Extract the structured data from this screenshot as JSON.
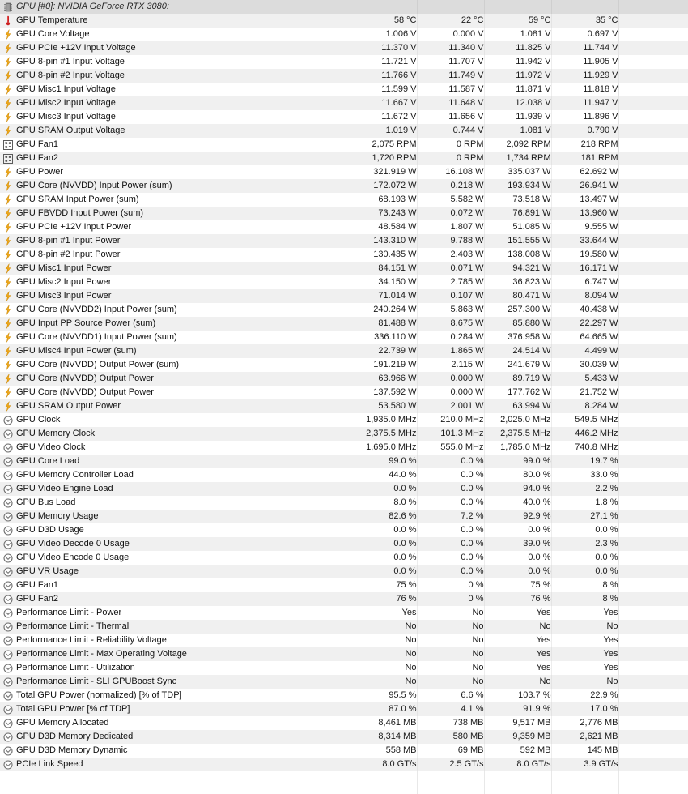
{
  "window": {
    "title": "GPU [#0]: NVIDIA GeForce RTX 3080:",
    "device_icon": "chip-icon"
  },
  "colors": {
    "row_odd": "#f0f0f0",
    "row_even": "#ffffff",
    "header_band": "#dcdcdc",
    "divider": "#e4e4e4",
    "thermometer": "#cc2020",
    "bolt": "#f0a818",
    "fan": "#5b5b5b",
    "gauge": "#6e6e6e",
    "text": "#111111"
  },
  "columns": {
    "label": "",
    "current": "",
    "minimum": "",
    "maximum": "",
    "average": ""
  },
  "rows": [
    {
      "icon": "thermometer-icon",
      "label": "GPU Temperature",
      "current": "58 °C",
      "minimum": "22 °C",
      "maximum": "59 °C",
      "average": "35 °C"
    },
    {
      "icon": "bolt-icon",
      "label": "GPU Core Voltage",
      "current": "1.006 V",
      "minimum": "0.000 V",
      "maximum": "1.081 V",
      "average": "0.697 V"
    },
    {
      "icon": "bolt-icon",
      "label": "GPU PCIe +12V Input Voltage",
      "current": "11.370 V",
      "minimum": "11.340 V",
      "maximum": "11.825 V",
      "average": "11.744 V"
    },
    {
      "icon": "bolt-icon",
      "label": "GPU 8-pin #1 Input Voltage",
      "current": "11.721 V",
      "minimum": "11.707 V",
      "maximum": "11.942 V",
      "average": "11.905 V"
    },
    {
      "icon": "bolt-icon",
      "label": "GPU 8-pin #2 Input Voltage",
      "current": "11.766 V",
      "minimum": "11.749 V",
      "maximum": "11.972 V",
      "average": "11.929 V"
    },
    {
      "icon": "bolt-icon",
      "label": "GPU Misc1 Input Voltage",
      "current": "11.599 V",
      "minimum": "11.587 V",
      "maximum": "11.871 V",
      "average": "11.818 V"
    },
    {
      "icon": "bolt-icon",
      "label": "GPU Misc2 Input Voltage",
      "current": "11.667 V",
      "minimum": "11.648 V",
      "maximum": "12.038 V",
      "average": "11.947 V"
    },
    {
      "icon": "bolt-icon",
      "label": "GPU Misc3 Input Voltage",
      "current": "11.672 V",
      "minimum": "11.656 V",
      "maximum": "11.939 V",
      "average": "11.896 V"
    },
    {
      "icon": "bolt-icon",
      "label": "GPU SRAM Output Voltage",
      "current": "1.019 V",
      "minimum": "0.744 V",
      "maximum": "1.081 V",
      "average": "0.790 V"
    },
    {
      "icon": "fan-icon",
      "label": "GPU Fan1",
      "current": "2,075 RPM",
      "minimum": "0 RPM",
      "maximum": "2,092 RPM",
      "average": "218 RPM"
    },
    {
      "icon": "fan-icon",
      "label": "GPU Fan2",
      "current": "1,720 RPM",
      "minimum": "0 RPM",
      "maximum": "1,734 RPM",
      "average": "181 RPM"
    },
    {
      "icon": "bolt-icon",
      "label": "GPU Power",
      "current": "321.919 W",
      "minimum": "16.108 W",
      "maximum": "335.037 W",
      "average": "62.692 W"
    },
    {
      "icon": "bolt-icon",
      "label": "GPU Core (NVVDD) Input Power (sum)",
      "current": "172.072 W",
      "minimum": "0.218 W",
      "maximum": "193.934 W",
      "average": "26.941 W"
    },
    {
      "icon": "bolt-icon",
      "label": "GPU SRAM Input Power (sum)",
      "current": "68.193 W",
      "minimum": "5.582 W",
      "maximum": "73.518 W",
      "average": "13.497 W"
    },
    {
      "icon": "bolt-icon",
      "label": "GPU FBVDD Input Power (sum)",
      "current": "73.243 W",
      "minimum": "0.072 W",
      "maximum": "76.891 W",
      "average": "13.960 W"
    },
    {
      "icon": "bolt-icon",
      "label": "GPU PCIe +12V Input Power",
      "current": "48.584 W",
      "minimum": "1.807 W",
      "maximum": "51.085 W",
      "average": "9.555 W"
    },
    {
      "icon": "bolt-icon",
      "label": "GPU 8-pin #1 Input Power",
      "current": "143.310 W",
      "minimum": "9.788 W",
      "maximum": "151.555 W",
      "average": "33.644 W"
    },
    {
      "icon": "bolt-icon",
      "label": "GPU 8-pin #2 Input Power",
      "current": "130.435 W",
      "minimum": "2.403 W",
      "maximum": "138.008 W",
      "average": "19.580 W"
    },
    {
      "icon": "bolt-icon",
      "label": "GPU Misc1 Input Power",
      "current": "84.151 W",
      "minimum": "0.071 W",
      "maximum": "94.321 W",
      "average": "16.171 W"
    },
    {
      "icon": "bolt-icon",
      "label": "GPU Misc2 Input Power",
      "current": "34.150 W",
      "minimum": "2.785 W",
      "maximum": "36.823 W",
      "average": "6.747 W"
    },
    {
      "icon": "bolt-icon",
      "label": "GPU Misc3 Input Power",
      "current": "71.014 W",
      "minimum": "0.107 W",
      "maximum": "80.471 W",
      "average": "8.094 W"
    },
    {
      "icon": "bolt-icon",
      "label": "GPU Core (NVVDD2) Input Power (sum)",
      "current": "240.264 W",
      "minimum": "5.863 W",
      "maximum": "257.300 W",
      "average": "40.438 W"
    },
    {
      "icon": "bolt-icon",
      "label": "GPU Input PP Source Power (sum)",
      "current": "81.488 W",
      "minimum": "8.675 W",
      "maximum": "85.880 W",
      "average": "22.297 W"
    },
    {
      "icon": "bolt-icon",
      "label": "GPU Core (NVVDD1) Input Power (sum)",
      "current": "336.110 W",
      "minimum": "0.284 W",
      "maximum": "376.958 W",
      "average": "64.665 W"
    },
    {
      "icon": "bolt-icon",
      "label": "GPU Misc4 Input Power (sum)",
      "current": "22.739 W",
      "minimum": "1.865 W",
      "maximum": "24.514 W",
      "average": "4.499 W"
    },
    {
      "icon": "bolt-icon",
      "label": "GPU Core (NVVDD) Output Power (sum)",
      "current": "191.219 W",
      "minimum": "2.115 W",
      "maximum": "241.679 W",
      "average": "30.039 W"
    },
    {
      "icon": "bolt-icon",
      "label": "GPU Core (NVVDD) Output Power",
      "current": "63.966 W",
      "minimum": "0.000 W",
      "maximum": "89.719 W",
      "average": "5.433 W"
    },
    {
      "icon": "bolt-icon",
      "label": "GPU Core (NVVDD) Output Power",
      "current": "137.592 W",
      "minimum": "0.000 W",
      "maximum": "177.762 W",
      "average": "21.752 W"
    },
    {
      "icon": "bolt-icon",
      "label": "GPU SRAM Output Power",
      "current": "53.580 W",
      "minimum": "2.001 W",
      "maximum": "63.994 W",
      "average": "8.284 W"
    },
    {
      "icon": "gauge-icon",
      "label": "GPU Clock",
      "current": "1,935.0 MHz",
      "minimum": "210.0 MHz",
      "maximum": "2,025.0 MHz",
      "average": "549.5 MHz"
    },
    {
      "icon": "gauge-icon",
      "label": "GPU Memory Clock",
      "current": "2,375.5 MHz",
      "minimum": "101.3 MHz",
      "maximum": "2,375.5 MHz",
      "average": "446.2 MHz"
    },
    {
      "icon": "gauge-icon",
      "label": "GPU Video Clock",
      "current": "1,695.0 MHz",
      "minimum": "555.0 MHz",
      "maximum": "1,785.0 MHz",
      "average": "740.8 MHz"
    },
    {
      "icon": "gauge-icon",
      "label": "GPU Core Load",
      "current": "99.0 %",
      "minimum": "0.0 %",
      "maximum": "99.0 %",
      "average": "19.7 %"
    },
    {
      "icon": "gauge-icon",
      "label": "GPU Memory Controller Load",
      "current": "44.0 %",
      "minimum": "0.0 %",
      "maximum": "80.0 %",
      "average": "33.0 %"
    },
    {
      "icon": "gauge-icon",
      "label": "GPU Video Engine Load",
      "current": "0.0 %",
      "minimum": "0.0 %",
      "maximum": "94.0 %",
      "average": "2.2 %"
    },
    {
      "icon": "gauge-icon",
      "label": "GPU Bus Load",
      "current": "8.0 %",
      "minimum": "0.0 %",
      "maximum": "40.0 %",
      "average": "1.8 %"
    },
    {
      "icon": "gauge-icon",
      "label": "GPU Memory Usage",
      "current": "82.6 %",
      "minimum": "7.2 %",
      "maximum": "92.9 %",
      "average": "27.1 %"
    },
    {
      "icon": "gauge-icon",
      "label": "GPU D3D Usage",
      "current": "0.0 %",
      "minimum": "0.0 %",
      "maximum": "0.0 %",
      "average": "0.0 %"
    },
    {
      "icon": "gauge-icon",
      "label": "GPU Video Decode 0 Usage",
      "current": "0.0 %",
      "minimum": "0.0 %",
      "maximum": "39.0 %",
      "average": "2.3 %"
    },
    {
      "icon": "gauge-icon",
      "label": "GPU Video Encode 0 Usage",
      "current": "0.0 %",
      "minimum": "0.0 %",
      "maximum": "0.0 %",
      "average": "0.0 %"
    },
    {
      "icon": "gauge-icon",
      "label": "GPU VR Usage",
      "current": "0.0 %",
      "minimum": "0.0 %",
      "maximum": "0.0 %",
      "average": "0.0 %"
    },
    {
      "icon": "gauge-icon",
      "label": "GPU Fan1",
      "current": "75 %",
      "minimum": "0 %",
      "maximum": "75 %",
      "average": "8 %"
    },
    {
      "icon": "gauge-icon",
      "label": "GPU Fan2",
      "current": "76 %",
      "minimum": "0 %",
      "maximum": "76 %",
      "average": "8 %"
    },
    {
      "icon": "gauge-icon",
      "label": "Performance Limit - Power",
      "current": "Yes",
      "minimum": "No",
      "maximum": "Yes",
      "average": "Yes"
    },
    {
      "icon": "gauge-icon",
      "label": "Performance Limit - Thermal",
      "current": "No",
      "minimum": "No",
      "maximum": "No",
      "average": "No"
    },
    {
      "icon": "gauge-icon",
      "label": "Performance Limit - Reliability Voltage",
      "current": "No",
      "minimum": "No",
      "maximum": "Yes",
      "average": "Yes"
    },
    {
      "icon": "gauge-icon",
      "label": "Performance Limit - Max Operating Voltage",
      "current": "No",
      "minimum": "No",
      "maximum": "Yes",
      "average": "Yes"
    },
    {
      "icon": "gauge-icon",
      "label": "Performance Limit - Utilization",
      "current": "No",
      "minimum": "No",
      "maximum": "Yes",
      "average": "Yes"
    },
    {
      "icon": "gauge-icon",
      "label": "Performance Limit - SLI GPUBoost Sync",
      "current": "No",
      "minimum": "No",
      "maximum": "No",
      "average": "No"
    },
    {
      "icon": "gauge-icon",
      "label": "Total GPU Power (normalized) [% of TDP]",
      "current": "95.5 %",
      "minimum": "6.6 %",
      "maximum": "103.7 %",
      "average": "22.9 %"
    },
    {
      "icon": "gauge-icon",
      "label": "Total GPU Power [% of TDP]",
      "current": "87.0 %",
      "minimum": "4.1 %",
      "maximum": "91.9 %",
      "average": "17.0 %"
    },
    {
      "icon": "gauge-icon",
      "label": "GPU Memory Allocated",
      "current": "8,461 MB",
      "minimum": "738 MB",
      "maximum": "9,517 MB",
      "average": "2,776 MB"
    },
    {
      "icon": "gauge-icon",
      "label": "GPU D3D Memory Dedicated",
      "current": "8,314 MB",
      "minimum": "580 MB",
      "maximum": "9,359 MB",
      "average": "2,621 MB"
    },
    {
      "icon": "gauge-icon",
      "label": "GPU D3D Memory Dynamic",
      "current": "558 MB",
      "minimum": "69 MB",
      "maximum": "592 MB",
      "average": "145 MB"
    },
    {
      "icon": "gauge-icon",
      "label": "PCIe Link Speed",
      "current": "8.0 GT/s",
      "minimum": "2.5 GT/s",
      "maximum": "8.0 GT/s",
      "average": "3.9 GT/s"
    }
  ]
}
